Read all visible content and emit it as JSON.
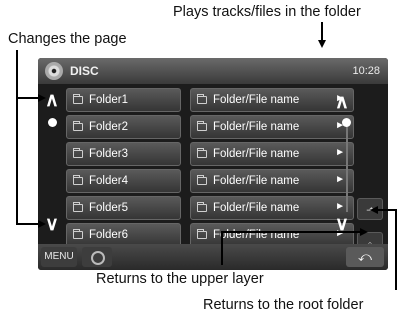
{
  "callouts": {
    "plays": "Plays tracks/files in the folder",
    "changes": "Changes the page",
    "upper": "Returns to the upper layer",
    "root": "Returns to the root folder"
  },
  "header": {
    "title": "DISC",
    "clock": "10:28",
    "icon": "disc-icon"
  },
  "left_list": [
    {
      "label": "Folder1"
    },
    {
      "label": "Folder2"
    },
    {
      "label": "Folder3"
    },
    {
      "label": "Folder4"
    },
    {
      "label": "Folder5"
    },
    {
      "label": "Folder6"
    }
  ],
  "right_list": [
    {
      "label": "Folder/File name"
    },
    {
      "label": "Folder/File name"
    },
    {
      "label": "Folder/File name"
    },
    {
      "label": "Folder/File name"
    },
    {
      "label": "Folder/File name"
    },
    {
      "label": "Folder/File name"
    }
  ],
  "scroll": {
    "up": "∧",
    "down": "∨"
  },
  "bottom_bar": {
    "menu": "MENU",
    "back": "⤺"
  },
  "side": {
    "upper_icon": "folder-up-icon",
    "root_icon": "folder-root-icon"
  }
}
